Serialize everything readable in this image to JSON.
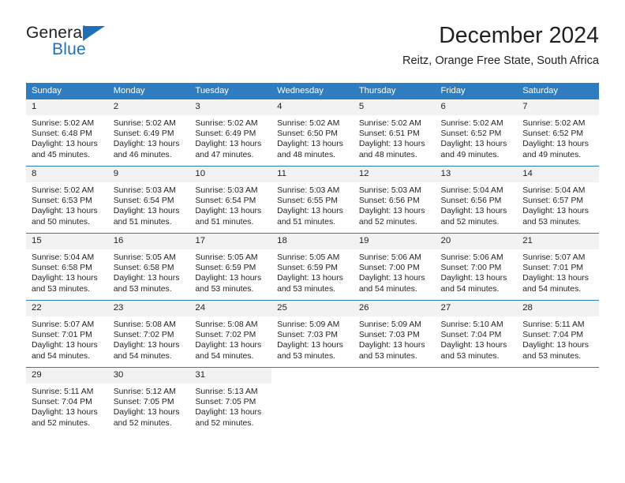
{
  "logo": {
    "word_top": "General",
    "word_bottom": "Blue",
    "triangle_color": "#1f70b8"
  },
  "header": {
    "title": "December 2024",
    "subtitle": "Reitz, Orange Free State, South Africa"
  },
  "theme": {
    "header_blue": "#2e7dc1",
    "daynum_gray": "#f2f2f2",
    "text": "#231f20"
  },
  "weekdays": [
    "Sunday",
    "Monday",
    "Tuesday",
    "Wednesday",
    "Thursday",
    "Friday",
    "Saturday"
  ],
  "weeks": [
    [
      {
        "day": "1",
        "sunrise": "Sunrise: 5:02 AM",
        "sunset": "Sunset: 6:48 PM",
        "daylight_line1": "Daylight: 13 hours",
        "daylight_line2": "and 45 minutes."
      },
      {
        "day": "2",
        "sunrise": "Sunrise: 5:02 AM",
        "sunset": "Sunset: 6:49 PM",
        "daylight_line1": "Daylight: 13 hours",
        "daylight_line2": "and 46 minutes."
      },
      {
        "day": "3",
        "sunrise": "Sunrise: 5:02 AM",
        "sunset": "Sunset: 6:49 PM",
        "daylight_line1": "Daylight: 13 hours",
        "daylight_line2": "and 47 minutes."
      },
      {
        "day": "4",
        "sunrise": "Sunrise: 5:02 AM",
        "sunset": "Sunset: 6:50 PM",
        "daylight_line1": "Daylight: 13 hours",
        "daylight_line2": "and 48 minutes."
      },
      {
        "day": "5",
        "sunrise": "Sunrise: 5:02 AM",
        "sunset": "Sunset: 6:51 PM",
        "daylight_line1": "Daylight: 13 hours",
        "daylight_line2": "and 48 minutes."
      },
      {
        "day": "6",
        "sunrise": "Sunrise: 5:02 AM",
        "sunset": "Sunset: 6:52 PM",
        "daylight_line1": "Daylight: 13 hours",
        "daylight_line2": "and 49 minutes."
      },
      {
        "day": "7",
        "sunrise": "Sunrise: 5:02 AM",
        "sunset": "Sunset: 6:52 PM",
        "daylight_line1": "Daylight: 13 hours",
        "daylight_line2": "and 49 minutes."
      }
    ],
    [
      {
        "day": "8",
        "sunrise": "Sunrise: 5:02 AM",
        "sunset": "Sunset: 6:53 PM",
        "daylight_line1": "Daylight: 13 hours",
        "daylight_line2": "and 50 minutes."
      },
      {
        "day": "9",
        "sunrise": "Sunrise: 5:03 AM",
        "sunset": "Sunset: 6:54 PM",
        "daylight_line1": "Daylight: 13 hours",
        "daylight_line2": "and 51 minutes."
      },
      {
        "day": "10",
        "sunrise": "Sunrise: 5:03 AM",
        "sunset": "Sunset: 6:54 PM",
        "daylight_line1": "Daylight: 13 hours",
        "daylight_line2": "and 51 minutes."
      },
      {
        "day": "11",
        "sunrise": "Sunrise: 5:03 AM",
        "sunset": "Sunset: 6:55 PM",
        "daylight_line1": "Daylight: 13 hours",
        "daylight_line2": "and 51 minutes."
      },
      {
        "day": "12",
        "sunrise": "Sunrise: 5:03 AM",
        "sunset": "Sunset: 6:56 PM",
        "daylight_line1": "Daylight: 13 hours",
        "daylight_line2": "and 52 minutes."
      },
      {
        "day": "13",
        "sunrise": "Sunrise: 5:04 AM",
        "sunset": "Sunset: 6:56 PM",
        "daylight_line1": "Daylight: 13 hours",
        "daylight_line2": "and 52 minutes."
      },
      {
        "day": "14",
        "sunrise": "Sunrise: 5:04 AM",
        "sunset": "Sunset: 6:57 PM",
        "daylight_line1": "Daylight: 13 hours",
        "daylight_line2": "and 53 minutes."
      }
    ],
    [
      {
        "day": "15",
        "sunrise": "Sunrise: 5:04 AM",
        "sunset": "Sunset: 6:58 PM",
        "daylight_line1": "Daylight: 13 hours",
        "daylight_line2": "and 53 minutes."
      },
      {
        "day": "16",
        "sunrise": "Sunrise: 5:05 AM",
        "sunset": "Sunset: 6:58 PM",
        "daylight_line1": "Daylight: 13 hours",
        "daylight_line2": "and 53 minutes."
      },
      {
        "day": "17",
        "sunrise": "Sunrise: 5:05 AM",
        "sunset": "Sunset: 6:59 PM",
        "daylight_line1": "Daylight: 13 hours",
        "daylight_line2": "and 53 minutes."
      },
      {
        "day": "18",
        "sunrise": "Sunrise: 5:05 AM",
        "sunset": "Sunset: 6:59 PM",
        "daylight_line1": "Daylight: 13 hours",
        "daylight_line2": "and 53 minutes."
      },
      {
        "day": "19",
        "sunrise": "Sunrise: 5:06 AM",
        "sunset": "Sunset: 7:00 PM",
        "daylight_line1": "Daylight: 13 hours",
        "daylight_line2": "and 54 minutes."
      },
      {
        "day": "20",
        "sunrise": "Sunrise: 5:06 AM",
        "sunset": "Sunset: 7:00 PM",
        "daylight_line1": "Daylight: 13 hours",
        "daylight_line2": "and 54 minutes."
      },
      {
        "day": "21",
        "sunrise": "Sunrise: 5:07 AM",
        "sunset": "Sunset: 7:01 PM",
        "daylight_line1": "Daylight: 13 hours",
        "daylight_line2": "and 54 minutes."
      }
    ],
    [
      {
        "day": "22",
        "sunrise": "Sunrise: 5:07 AM",
        "sunset": "Sunset: 7:01 PM",
        "daylight_line1": "Daylight: 13 hours",
        "daylight_line2": "and 54 minutes."
      },
      {
        "day": "23",
        "sunrise": "Sunrise: 5:08 AM",
        "sunset": "Sunset: 7:02 PM",
        "daylight_line1": "Daylight: 13 hours",
        "daylight_line2": "and 54 minutes."
      },
      {
        "day": "24",
        "sunrise": "Sunrise: 5:08 AM",
        "sunset": "Sunset: 7:02 PM",
        "daylight_line1": "Daylight: 13 hours",
        "daylight_line2": "and 54 minutes."
      },
      {
        "day": "25",
        "sunrise": "Sunrise: 5:09 AM",
        "sunset": "Sunset: 7:03 PM",
        "daylight_line1": "Daylight: 13 hours",
        "daylight_line2": "and 53 minutes."
      },
      {
        "day": "26",
        "sunrise": "Sunrise: 5:09 AM",
        "sunset": "Sunset: 7:03 PM",
        "daylight_line1": "Daylight: 13 hours",
        "daylight_line2": "and 53 minutes."
      },
      {
        "day": "27",
        "sunrise": "Sunrise: 5:10 AM",
        "sunset": "Sunset: 7:04 PM",
        "daylight_line1": "Daylight: 13 hours",
        "daylight_line2": "and 53 minutes."
      },
      {
        "day": "28",
        "sunrise": "Sunrise: 5:11 AM",
        "sunset": "Sunset: 7:04 PM",
        "daylight_line1": "Daylight: 13 hours",
        "daylight_line2": "and 53 minutes."
      }
    ],
    [
      {
        "day": "29",
        "sunrise": "Sunrise: 5:11 AM",
        "sunset": "Sunset: 7:04 PM",
        "daylight_line1": "Daylight: 13 hours",
        "daylight_line2": "and 52 minutes."
      },
      {
        "day": "30",
        "sunrise": "Sunrise: 5:12 AM",
        "sunset": "Sunset: 7:05 PM",
        "daylight_line1": "Daylight: 13 hours",
        "daylight_line2": "and 52 minutes."
      },
      {
        "day": "31",
        "sunrise": "Sunrise: 5:13 AM",
        "sunset": "Sunset: 7:05 PM",
        "daylight_line1": "Daylight: 13 hours",
        "daylight_line2": "and 52 minutes."
      },
      {
        "day": "",
        "sunrise": "",
        "sunset": "",
        "daylight_line1": "",
        "daylight_line2": ""
      },
      {
        "day": "",
        "sunrise": "",
        "sunset": "",
        "daylight_line1": "",
        "daylight_line2": ""
      },
      {
        "day": "",
        "sunrise": "",
        "sunset": "",
        "daylight_line1": "",
        "daylight_line2": ""
      },
      {
        "day": "",
        "sunrise": "",
        "sunset": "",
        "daylight_line1": "",
        "daylight_line2": ""
      }
    ]
  ]
}
